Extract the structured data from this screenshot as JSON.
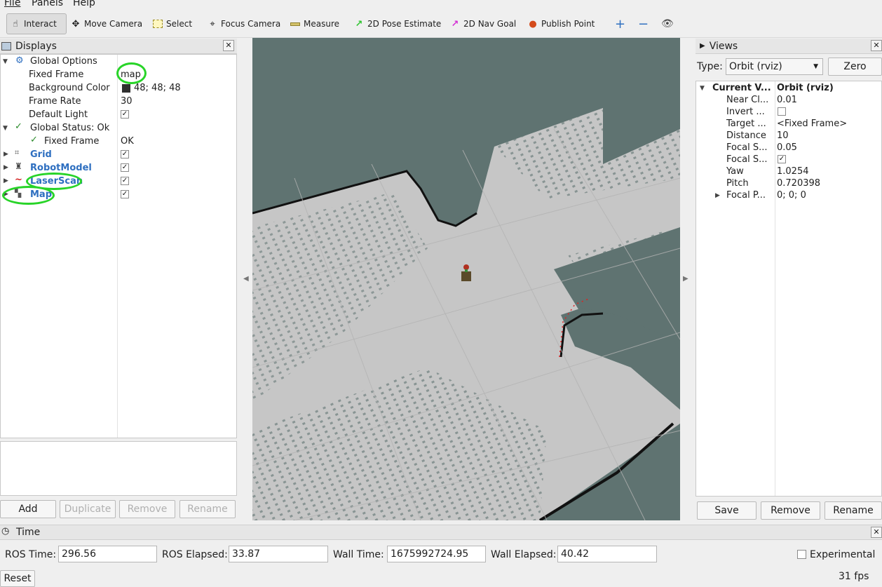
{
  "menu": {
    "file": "File",
    "panels": "Panels",
    "help": "Help"
  },
  "toolbar": {
    "interact": "Interact",
    "move_camera": "Move Camera",
    "select": "Select",
    "focus_camera": "Focus Camera",
    "measure": "Measure",
    "pose_estimate": "2D Pose Estimate",
    "nav_goal": "2D Nav Goal",
    "publish_point": "Publish Point"
  },
  "displays": {
    "title": "Displays",
    "global_options": "Global Options",
    "fixed_frame_label": "Fixed Frame",
    "fixed_frame_value": "map",
    "bg_color_label": "Background Color",
    "bg_color_value": "48; 48; 48",
    "frame_rate_label": "Frame Rate",
    "frame_rate_value": "30",
    "default_light_label": "Default Light",
    "global_status": "Global Status: Ok",
    "status_fixed_frame": "Fixed Frame",
    "status_fixed_frame_value": "OK",
    "grid": "Grid",
    "robot_model": "RobotModel",
    "laser_scan": "LaserScan",
    "map": "Map"
  },
  "display_buttons": {
    "add": "Add",
    "duplicate": "Duplicate",
    "remove": "Remove",
    "rename": "Rename"
  },
  "views": {
    "title": "Views",
    "type_label": "Type:",
    "type_value": "Orbit (rviz)",
    "zero": "Zero",
    "current_view_label": "Current V...",
    "current_view_value": "Orbit (rviz)",
    "props": [
      {
        "label": "Near Cl...",
        "value": "0.01"
      },
      {
        "label": "Invert ...",
        "value": ""
      },
      {
        "label": "Target ...",
        "value": "<Fixed Frame>"
      },
      {
        "label": "Distance",
        "value": "10"
      },
      {
        "label": "Focal S...",
        "value": "0.05"
      },
      {
        "label": "Focal S...",
        "value": ""
      },
      {
        "label": "Yaw",
        "value": "1.0254"
      },
      {
        "label": "Pitch",
        "value": "0.720398"
      },
      {
        "label": "Focal P...",
        "value": "0; 0; 0"
      }
    ],
    "save": "Save",
    "remove": "Remove",
    "rename": "Rename"
  },
  "time": {
    "title": "Time",
    "ros_time_label": "ROS Time:",
    "ros_time": "296.56",
    "ros_elapsed_label": "ROS Elapsed:",
    "ros_elapsed": "33.87",
    "wall_time_label": "Wall Time:",
    "wall_time": "1675992724.95",
    "wall_elapsed_label": "Wall Elapsed:",
    "wall_elapsed": "40.42",
    "experimental": "Experimental",
    "reset": "Reset",
    "fps": "31 fps"
  },
  "colors": {
    "highlight": "#28d428",
    "viewport_bg": "#5f7371",
    "floor": "#c6c6c6",
    "display_blue": "#2e6fc0"
  }
}
